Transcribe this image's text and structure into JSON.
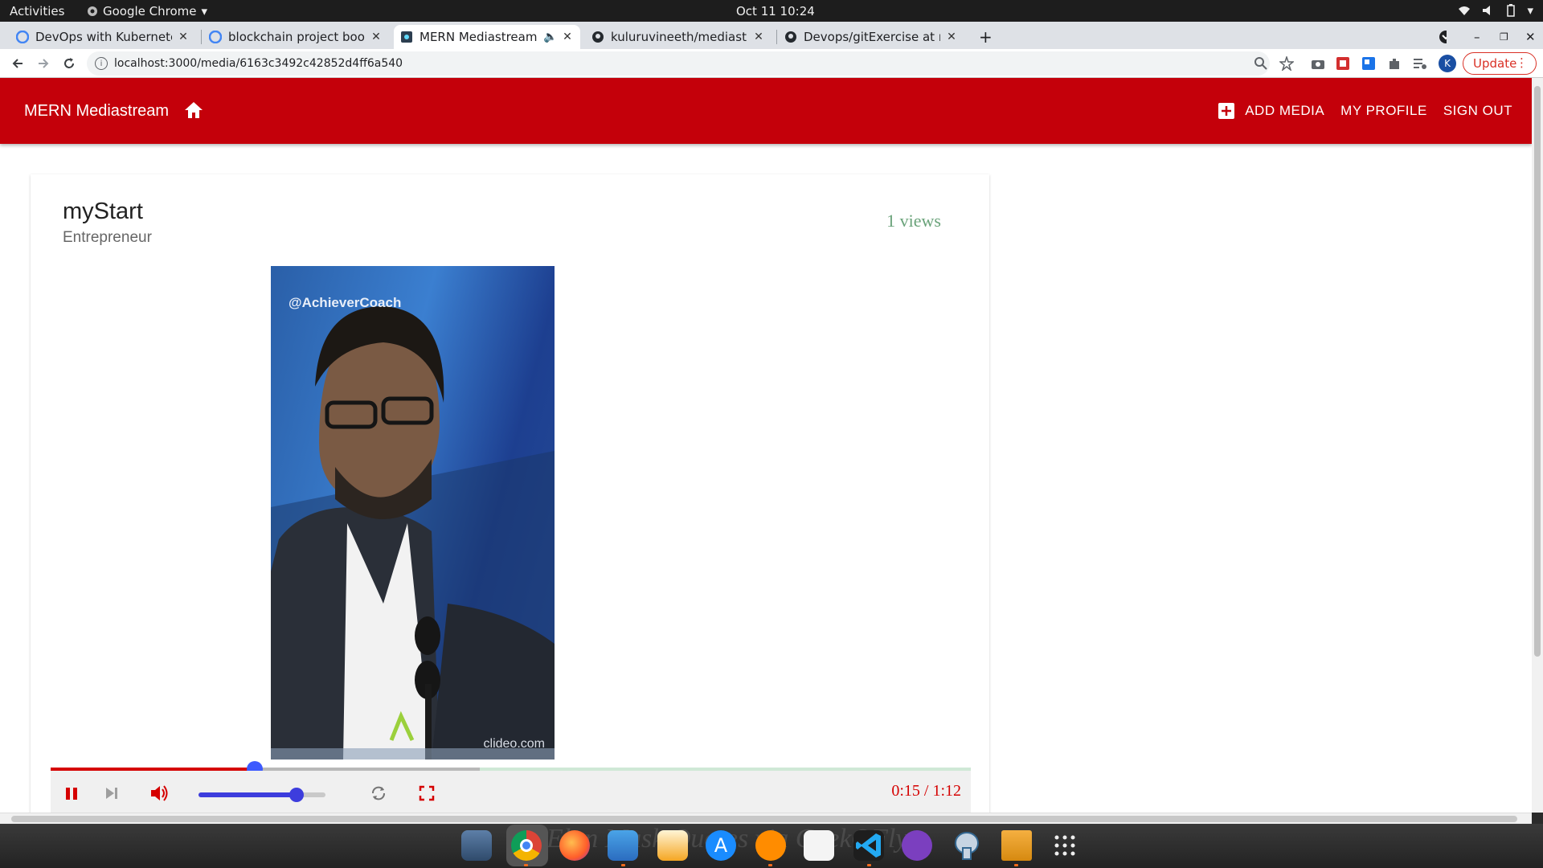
{
  "os": {
    "activities": "Activities",
    "app_name": "Google Chrome",
    "clock": "Oct 11  10:24"
  },
  "browser": {
    "tabs": [
      {
        "title": "DevOps with Kubernetes",
        "active": false
      },
      {
        "title": "blockchain project books",
        "active": false
      },
      {
        "title": "MERN Mediastream",
        "active": true
      },
      {
        "title": "kuluruvineeth/mediastre",
        "active": false
      },
      {
        "title": "Devops/gitExercise at ma",
        "active": false
      }
    ],
    "url": "localhost:3000/media/6163c3492c42852d4ff6a540",
    "update_label": "Update",
    "profile_initial": "K"
  },
  "app": {
    "brand": "MERN Mediastream",
    "nav": {
      "add_media": "ADD MEDIA",
      "my_profile": "MY PROFILE",
      "sign_out": "SIGN OUT"
    },
    "accent": "#c4000a"
  },
  "media": {
    "title": "myStart",
    "genre": "Entrepreneur",
    "views": "1 views",
    "video_handle": "@AchieverCoach",
    "video_watermark": "clideo.com",
    "time_display": "0:15 / 1:12",
    "played_fraction": 0.222,
    "loaded_fraction": 0.466,
    "volume_fraction": 0.77
  },
  "dock": {
    "wallpaper_text": "Elon Musk Quotes via GeekOFly",
    "apps": [
      "screenshot",
      "chrome",
      "firefox",
      "files",
      "text-editor",
      "app-store",
      "books",
      "notes",
      "vscode",
      "github-desktop",
      "postgres",
      "archive",
      "app-grid"
    ]
  }
}
